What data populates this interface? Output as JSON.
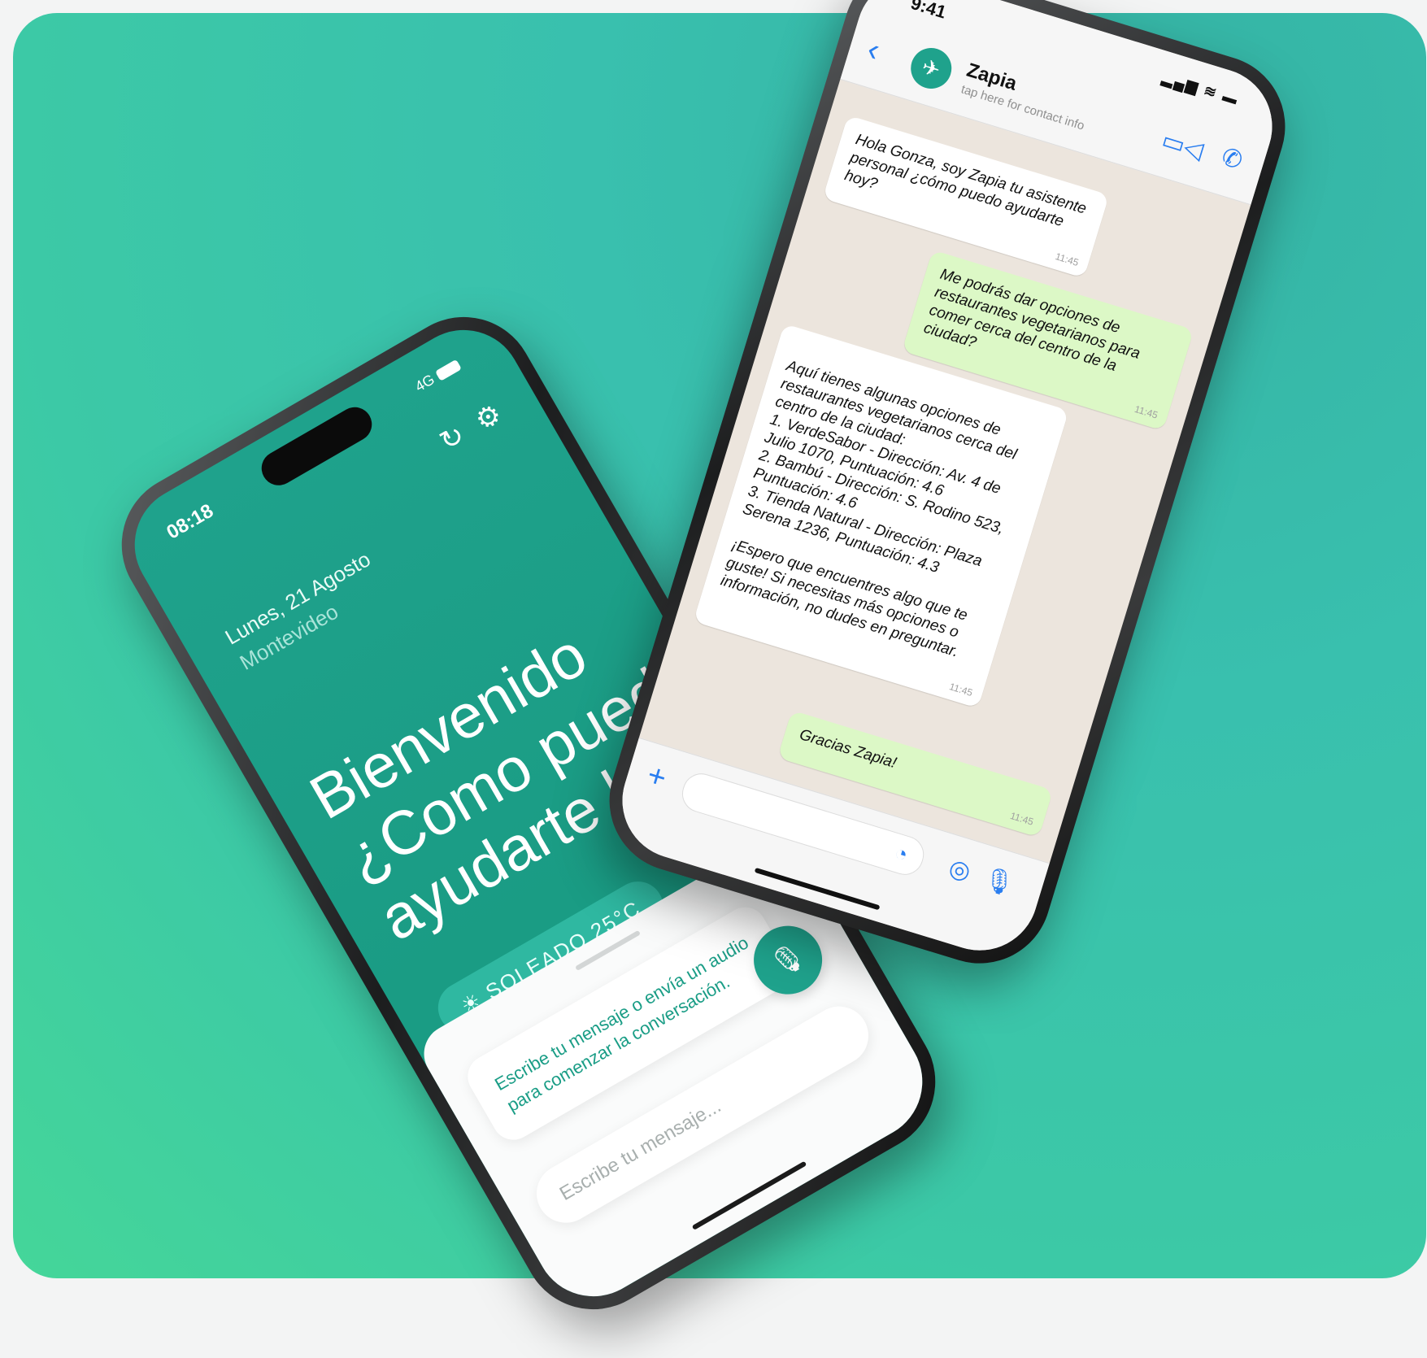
{
  "phone_welcome": {
    "status_time": "08:18",
    "status_network": "4G",
    "date": "Lunes, 21 Agosto",
    "city": "Montevideo",
    "welcome_line1": "Bienvenido",
    "welcome_line2": "¿Como puedo",
    "welcome_line3": "ayudarte hoy?",
    "weather": "SOLEADO 25°C",
    "prompt": "Escribe tu mensaje o envía un audio para comenzar la conversación.",
    "input_placeholder": "Escribe tu mensaje..."
  },
  "phone_chat": {
    "status_time": "9:41",
    "contact_name": "Zapia",
    "contact_sub": "tap here for contact info",
    "messages": [
      {
        "from": "bot",
        "text": "Hola Gonza, soy Zapia tu asistente personal ¿cómo puedo ayudarte hoy?",
        "time": "11:45"
      },
      {
        "from": "user",
        "text": "Me podrás dar opciones de restaurantes vegetarianos para comer cerca del centro de la ciudad?",
        "time": "11:45"
      },
      {
        "from": "bot",
        "text": "Aquí tienes algunas opciones de restaurantes vegetarianos cerca del centro de la ciudad:\n1. VerdeSabor - Dirección: Av. 4 de Julio 1070, Puntuación: 4.6\n2. Bambú - Dirección: S. Rodino 523, Puntuación: 4.6\n3. Tienda Natural - Dirección: Plaza Serena 1236, Puntuación: 4.3\n\n¡Espero que encuentres algo que te guste! Si necesitas más opciones o información, no dudes en preguntar.",
        "time": "11:45"
      },
      {
        "from": "user",
        "text": "Gracias Zapia!",
        "time": "11:45"
      }
    ]
  },
  "colors": {
    "brand_green": "#1fa28c",
    "link_blue": "#2a7ef0",
    "bubble_out": "#dcf8c6"
  }
}
